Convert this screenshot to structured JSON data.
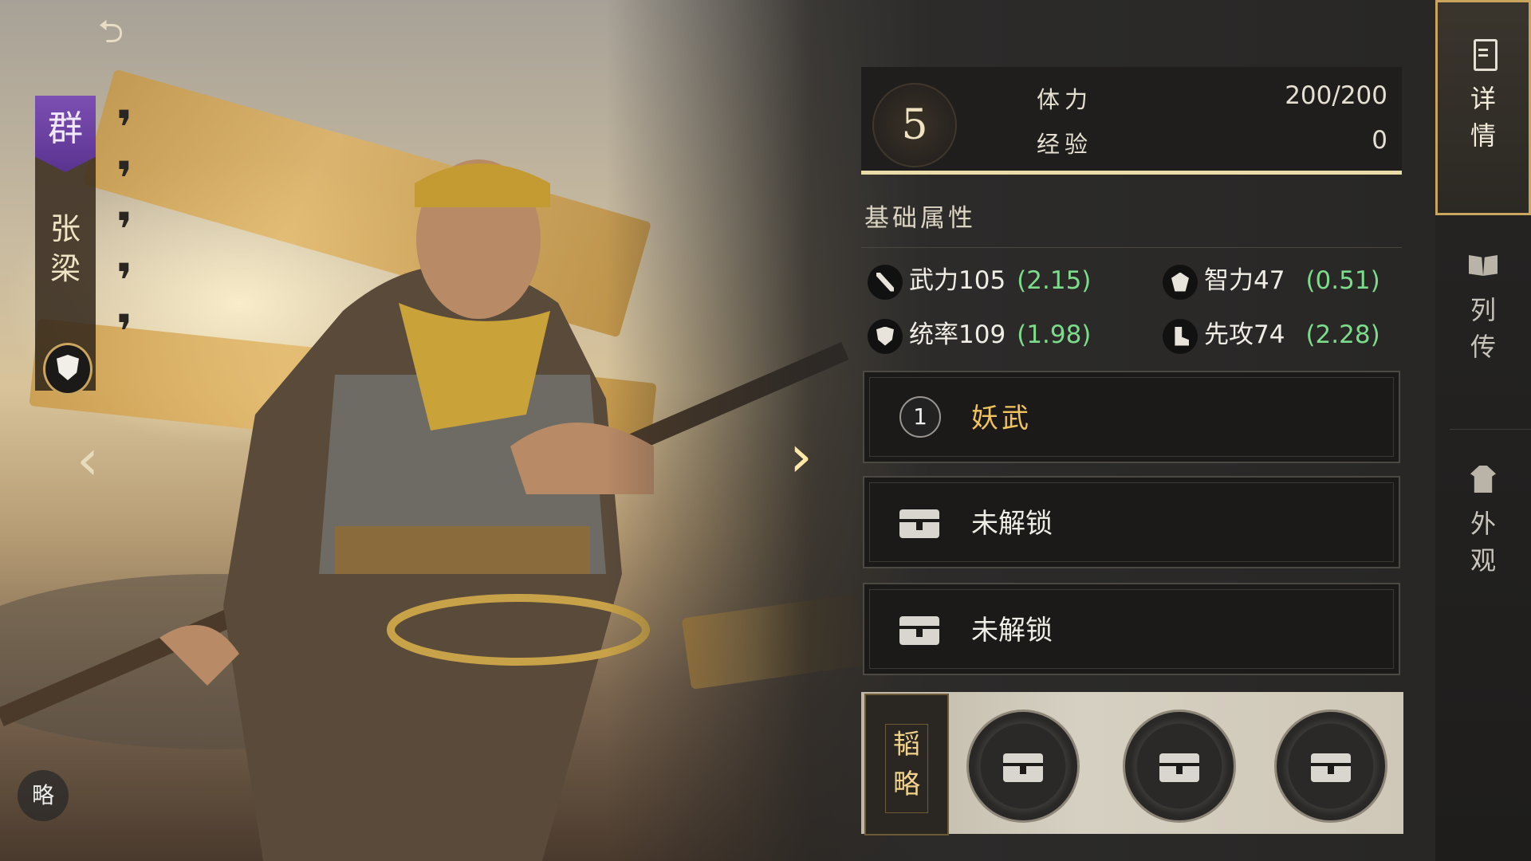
{
  "faction": "群",
  "hero_name": [
    "张",
    "梁"
  ],
  "level": "5",
  "stamina": {
    "label": "体力",
    "value": "200/200"
  },
  "experience": {
    "label": "经验",
    "value": "0"
  },
  "attributes_title": "基础属性",
  "attributes": [
    {
      "label": "武力",
      "value": "105",
      "growth": "(2.15)",
      "icon": "sword-icon"
    },
    {
      "label": "智力",
      "value": "47",
      "growth": "(0.51)",
      "icon": "brain-icon"
    },
    {
      "label": "统率",
      "value": "109",
      "growth": "(1.98)",
      "icon": "shield-icon"
    },
    {
      "label": "先攻",
      "value": "74",
      "growth": "(2.28)",
      "icon": "boot-icon"
    }
  ],
  "skills": [
    {
      "index": "1",
      "name": "妖武",
      "locked": false
    },
    {
      "name": "未解锁",
      "locked": true
    },
    {
      "name": "未解锁",
      "locked": true
    }
  ],
  "strategy": {
    "label": [
      "韬",
      "略"
    ],
    "slots": 3
  },
  "strategy_button": "略",
  "side_tabs": [
    {
      "label": [
        "详",
        "情"
      ],
      "icon": "clipboard-icon",
      "active": true
    },
    {
      "label": [
        "列",
        "传"
      ],
      "icon": "book-icon",
      "active": false
    },
    {
      "label": [
        "外",
        "观"
      ],
      "icon": "robe-icon",
      "active": false
    }
  ],
  "colors": {
    "gold_accent": "#c9a55e",
    "growth_green": "#7ddc8c",
    "skill_gold": "#f1c45c",
    "faction_purple": "#6b3fa0"
  }
}
